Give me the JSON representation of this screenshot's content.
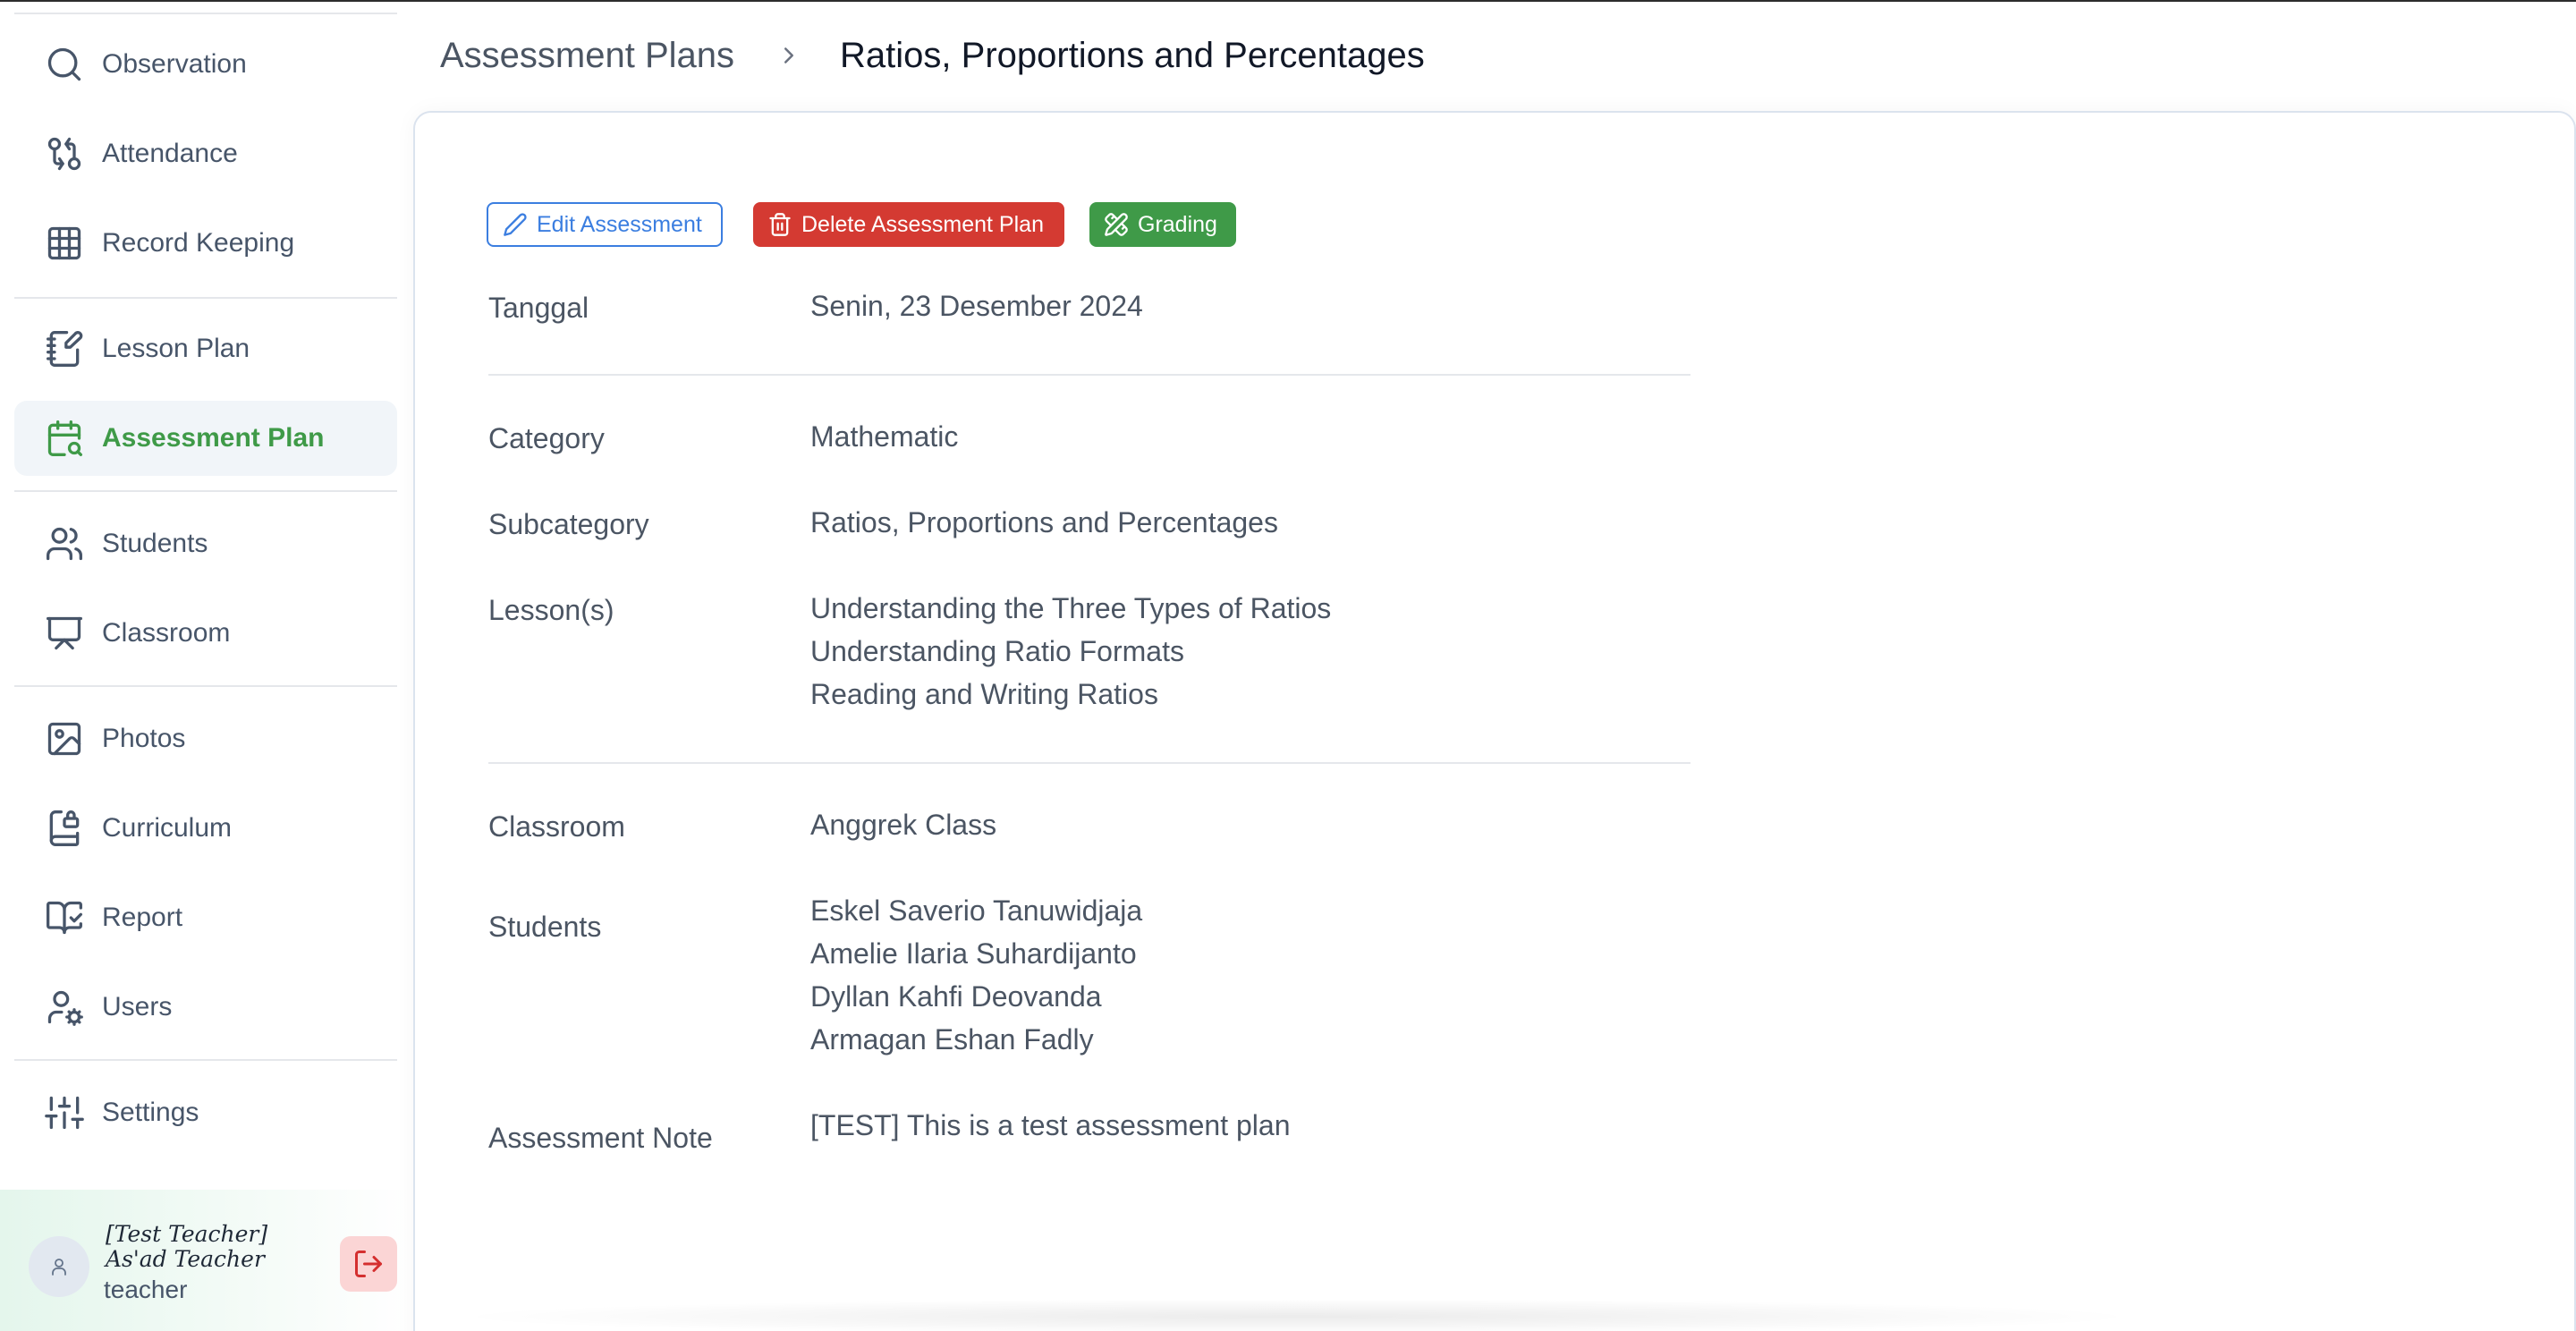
{
  "sidebar": {
    "items": [
      {
        "label": "Observation",
        "icon": "search-icon"
      },
      {
        "label": "Attendance",
        "icon": "git-compare-icon"
      },
      {
        "label": "Record Keeping",
        "icon": "grid-icon"
      },
      {
        "label": "Lesson Plan",
        "icon": "notebook-pen-icon"
      },
      {
        "label": "Assessment Plan",
        "icon": "calendar-search-icon",
        "active": true
      },
      {
        "label": "Students",
        "icon": "users-icon"
      },
      {
        "label": "Classroom",
        "icon": "presentation-icon"
      },
      {
        "label": "Photos",
        "icon": "image-icon"
      },
      {
        "label": "Curriculum",
        "icon": "book-lock-icon"
      },
      {
        "label": "Report",
        "icon": "book-check-icon"
      },
      {
        "label": "Users",
        "icon": "user-cog-icon"
      },
      {
        "label": "Settings",
        "icon": "sliders-icon"
      }
    ],
    "user": {
      "name": "[Test Teacher] As'ad Teacher",
      "role": "teacher"
    },
    "active_color": "#3f9a48"
  },
  "header": {
    "breadcrumb_parent": "Assessment Plans",
    "breadcrumb_current": "Ratios, Proportions and Percentages"
  },
  "actions": {
    "edit_label": "Edit Assessment",
    "delete_label": "Delete Assessment Plan",
    "grading_label": "Grading",
    "colors": {
      "edit": "#3b7ee0",
      "delete": "#d43a32",
      "grading": "#3f9a48"
    }
  },
  "details": {
    "date_label": "Tanggal",
    "date_value": "Senin, 23 Desember 2024",
    "category_label": "Category",
    "category_value": "Mathematic",
    "subcategory_label": "Subcategory",
    "subcategory_value": "Ratios, Proportions and Percentages",
    "lessons_label": "Lesson(s)",
    "lessons": [
      "Understanding the Three Types of Ratios",
      "Understanding Ratio Formats",
      "Reading and Writing Ratios"
    ],
    "classroom_label": "Classroom",
    "classroom_value": "Anggrek Class",
    "students_label": "Students",
    "students": [
      "Eskel Saverio Tanuwidjaja",
      "Amelie Ilaria Suhardijanto",
      "Dyllan Kahfi Deovanda",
      "Armagan Eshan Fadly"
    ],
    "note_label": "Assessment Note",
    "note_value": "[TEST] This is a test assessment plan"
  }
}
